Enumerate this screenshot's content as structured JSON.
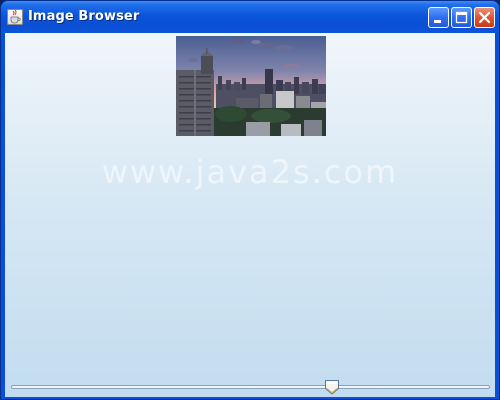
{
  "window": {
    "title": "Image Browser",
    "icon": "java-cup-icon",
    "controls": [
      "minimize-icon",
      "maximize-icon",
      "close-icon"
    ]
  },
  "image": {
    "description_icon": "city-skyline-photo"
  },
  "watermark": {
    "text": "www.java2s.com"
  },
  "slider": {
    "value_fraction": 0.67
  },
  "colors": {
    "titlebar": "#0b56dc",
    "background_top": "#f1f6fb",
    "background_bottom": "#c2dcef",
    "close_button": "#e0552f"
  }
}
